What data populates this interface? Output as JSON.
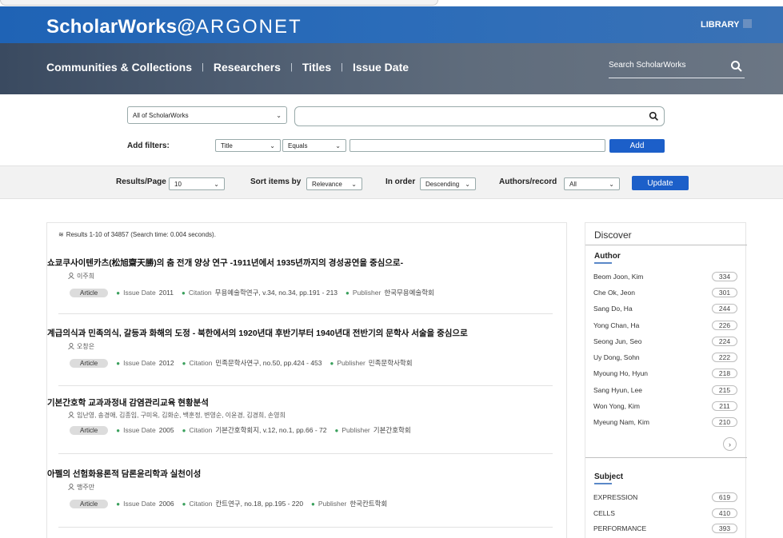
{
  "header": {
    "logo_main": "ScholarWorks@",
    "logo_sub": "ARGONET",
    "library": "LIBRARY",
    "nav": [
      "Communities & Collections",
      "Researchers",
      "Titles",
      "Issue Date"
    ],
    "search_placeholder": "Search ScholarWorks"
  },
  "query": {
    "scope": "All of ScholarWorks",
    "add_filters_label": "Add filters:",
    "filter_field": "Title",
    "filter_op": "Equals",
    "add_button": "Add"
  },
  "options": {
    "results_page_label": "Results/Page",
    "results_page_value": "10",
    "sort_label": "Sort items by",
    "sort_value": "Relevance",
    "order_label": "In order",
    "order_value": "Descending",
    "authors_label": "Authors/record",
    "authors_value": "All",
    "update_button": "Update"
  },
  "results": {
    "summary": "Results 1-10 of 34857 (Search time: 0.004 seconds).",
    "items": [
      {
        "title": "쇼쿄쿠사이텐카츠(松旭齋天勝)의 춤 전개 양상 연구 -1911년에서 1935년까지의 경성공연을 중심으로-",
        "authors": "이주희",
        "type": "Article",
        "issue_label": "Issue Date",
        "issue": "2011",
        "citation_label": "Citation",
        "citation": "무용예술학연구, v.34, no.34, pp.191 - 213",
        "publisher_label": "Publisher",
        "publisher": "한국무용예술학회"
      },
      {
        "title": "계급의식과 민족의식, 갈등과 화해의 도정 - 북한에서의 1920년대 후반기부터 1940년대 전반기의 문학사 서술을 중심으로",
        "authors": "오창은",
        "type": "Article",
        "issue_label": "Issue Date",
        "issue": "2012",
        "citation_label": "Citation",
        "citation": "민족문학사연구, no.50, pp.424 - 453",
        "publisher_label": "Publisher",
        "publisher": "민족문학사학회"
      },
      {
        "title": "기본간호학 교과과정내 감염관리교육 현황분석",
        "authors": "임난영, 송경애, 김종임, 구미옥, 김화순, 백훈정, 변영순, 이윤경, 김경희, 손영희",
        "type": "Article",
        "issue_label": "Issue Date",
        "issue": "2005",
        "citation_label": "Citation",
        "citation": "기본간호학회지, v.12, no.1, pp.66 - 72",
        "publisher_label": "Publisher",
        "publisher": "기본간호학회"
      },
      {
        "title": "아펠의 선험화용론적 담론윤리학과 실천이성",
        "authors": "맹주만",
        "type": "Article",
        "issue_label": "Issue Date",
        "issue": "2006",
        "citation_label": "Citation",
        "citation": "칸트연구, no.18, pp.195 - 220",
        "publisher_label": "Publisher",
        "publisher": "한국칸트학회"
      }
    ]
  },
  "sidebar": {
    "title": "Discover",
    "author_heading": "Author",
    "authors": [
      {
        "name": "Beom Joon, Kim",
        "count": "334"
      },
      {
        "name": "Che Ok, Jeon",
        "count": "301"
      },
      {
        "name": "Sang Do, Ha",
        "count": "244"
      },
      {
        "name": "Yong Chan, Ha",
        "count": "226"
      },
      {
        "name": "Seong Jun, Seo",
        "count": "224"
      },
      {
        "name": "Uy Dong, Sohn",
        "count": "222"
      },
      {
        "name": "Myoung Ho, Hyun",
        "count": "218"
      },
      {
        "name": "Sang Hyun, Lee",
        "count": "215"
      },
      {
        "name": "Won Yong, Kim",
        "count": "211"
      },
      {
        "name": "Myeung Nam, Kim",
        "count": "210"
      }
    ],
    "subject_heading": "Subject",
    "subjects": [
      {
        "name": "EXPRESSION",
        "count": "619"
      },
      {
        "name": "CELLS",
        "count": "410"
      },
      {
        "name": "PERFORMANCE",
        "count": "393"
      }
    ]
  }
}
